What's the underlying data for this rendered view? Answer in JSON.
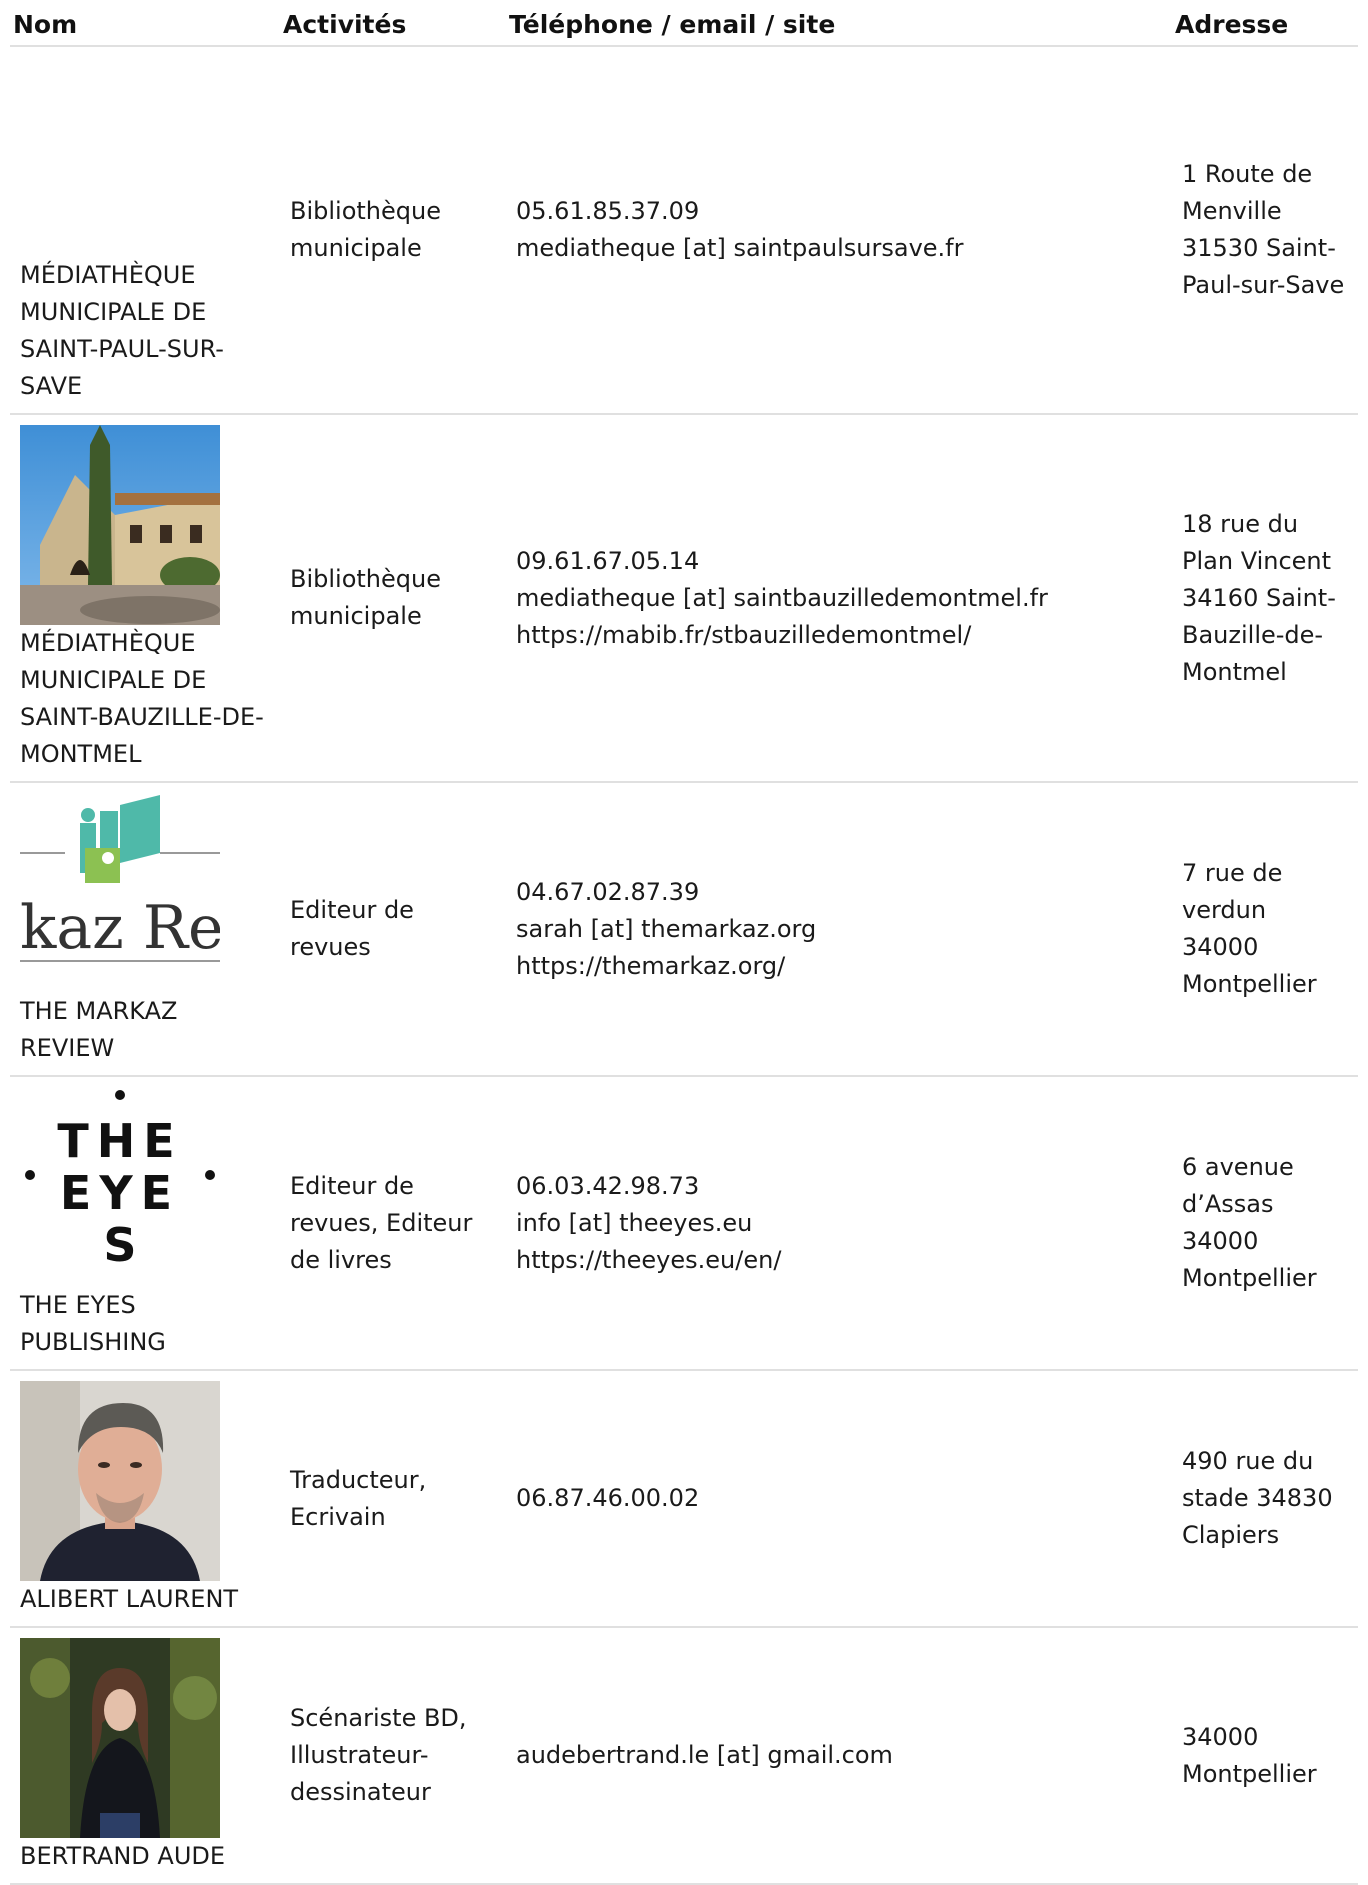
{
  "headers": {
    "nom": "Nom",
    "activites": "Activités",
    "contact": "Téléphone / email / site",
    "adresse": "Adresse"
  },
  "rows": [
    {
      "name": "MÉDIATHÈQUE MUNICIPALE DE SAINT-PAUL-SUR-SAVE",
      "image": "none",
      "activities": "Bibliothèque municipale",
      "phone": "05.61.85.37.09",
      "email": "mediatheque [at] saintpaulsursave.fr",
      "site": "",
      "address": "1 Route de Menville 31530 Saint-Paul-sur-Save"
    },
    {
      "name": "MÉDIATHÈQUE MUNICIPALE DE SAINT-BAUZILLE-DE-MONTMEL",
      "image": "stone-house-photo",
      "activities": "Bibliothèque municipale",
      "phone": "09.61.67.05.14",
      "email": "mediatheque [at] saintbauzilledemontmel.fr",
      "site": "https://mabib.fr/stbauzilledemontmel/",
      "address": "18 rue du Plan Vincent 34160 Saint-Bauzille-de-Montmel"
    },
    {
      "name": "THE MARKAZ REVIEW",
      "image": "markaz-logo",
      "logo_text": "kaz Rev",
      "activities": "Editeur de revues",
      "phone": "04.67.02.87.39",
      "email": "sarah [at] themarkaz.org",
      "site": "https://themarkaz.org/",
      "address": "7 rue de verdun 34000 Montpellier"
    },
    {
      "name": "THE EYES PUBLISHING",
      "image": "the-eyes-logo",
      "logo_lines": [
        "THE",
        "EYE",
        "S"
      ],
      "activities": "Editeur de revues, Editeur de livres",
      "phone": "06.03.42.98.73",
      "email": "info [at] theeyes.eu",
      "site": "https://theeyes.eu/en/",
      "address": "6 avenue d’Assas 34000 Montpellier"
    },
    {
      "name": "ALIBERT LAURENT",
      "image": "portrait-man-photo",
      "activities": "Traducteur, Ecrivain",
      "phone": "06.87.46.00.02",
      "email": "",
      "site": "",
      "address": "490 rue du stade 34830 Clapiers"
    },
    {
      "name": "BERTRAND AUDE",
      "image": "portrait-woman-photo",
      "activities": "Scénariste BD, Illustrateur-dessinateur",
      "phone": "",
      "email": "audebertrand.le [at] gmail.com",
      "site": "",
      "address": "34000 Montpellier"
    }
  ],
  "colors": {
    "border": "#e0e0e0",
    "text": "#1a1a1a",
    "teal": "#4fb9a9",
    "green": "#8cc152"
  }
}
